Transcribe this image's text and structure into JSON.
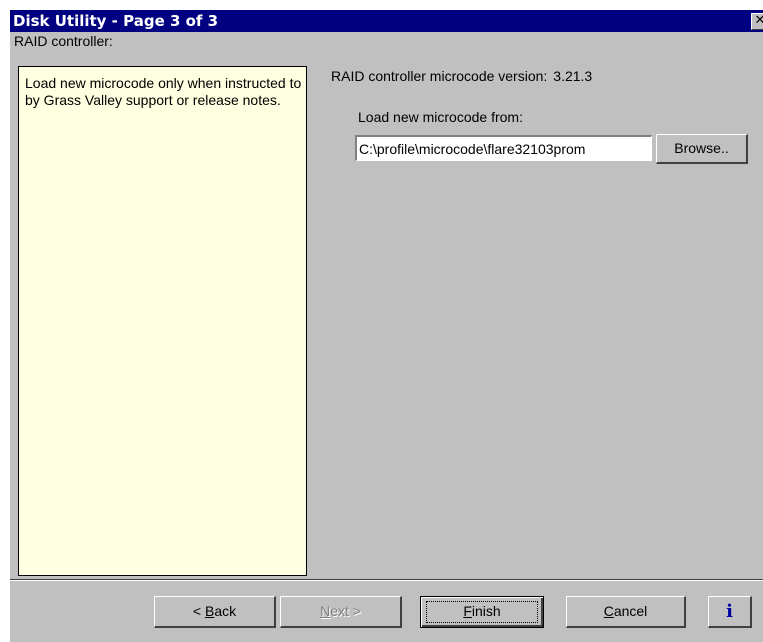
{
  "window": {
    "title": "Disk Utility - Page 3 of 3",
    "close_symbol": "✕"
  },
  "section": {
    "label": "RAID controller:"
  },
  "help_panel": {
    "text": "Load new microcode only when instructed to by Grass Valley support or release notes."
  },
  "raid": {
    "version_label": "RAID controller microcode version:",
    "version_value": "3.21.3",
    "load_label": "Load new microcode from:",
    "path_value": "C:\\profile\\microcode\\flare32103prom",
    "browse_label": "Browse.."
  },
  "buttons": {
    "back": {
      "prefix": "< ",
      "mnemonic": "B",
      "rest": "ack"
    },
    "next": {
      "mnemonic": "N",
      "rest": "ext >",
      "enabled": false
    },
    "finish": {
      "mnemonic": "F",
      "rest": "inish",
      "focused": true
    },
    "cancel": {
      "mnemonic": "C",
      "rest": "ancel"
    },
    "info": "i"
  },
  "colors": {
    "title_bar": "#000080",
    "dialog_face": "#c0c0c0",
    "help_background": "#ffffe1",
    "info_glyph": "#0000a0"
  },
  "icons": {
    "close": "close-icon",
    "info": "info-icon"
  }
}
